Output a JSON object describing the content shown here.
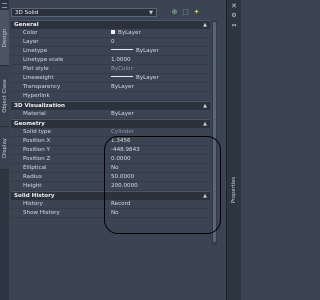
{
  "left_tabs": [
    "Design",
    "Object Class",
    "Display"
  ],
  "right_panel": {
    "label": "Properties"
  },
  "toolbar": {
    "selection": "3D Solid"
  },
  "categories": [
    {
      "title": "General",
      "rows": [
        {
          "name": "Color",
          "value": "ByLayer",
          "swatch": true
        },
        {
          "name": "Layer",
          "value": "0"
        },
        {
          "name": "Linetype",
          "value": "ByLayer",
          "line": true
        },
        {
          "name": "Linetype scale",
          "value": "1.0000"
        },
        {
          "name": "Plot style",
          "value": "ByColor",
          "style": "grey"
        },
        {
          "name": "Lineweight",
          "value": "ByLayer",
          "line": true
        },
        {
          "name": "Transparency",
          "value": "ByLayer"
        },
        {
          "name": "Hyperlink",
          "value": ""
        }
      ]
    },
    {
      "title": "3D Visualization",
      "rows": [
        {
          "name": "Material",
          "value": "ByLayer"
        }
      ]
    },
    {
      "title": "Geometry",
      "rows": [
        {
          "name": "Solid type",
          "value": "Cylinder",
          "style": "grey"
        },
        {
          "name": "Position X",
          "value": "1.3456"
        },
        {
          "name": "Position Y",
          "value": "-448.9843"
        },
        {
          "name": "Position Z",
          "value": "0.0000"
        },
        {
          "name": "Elliptical",
          "value": "No"
        },
        {
          "name": "Radius",
          "value": "50.0000"
        },
        {
          "name": "Height",
          "value": "200.0000"
        }
      ]
    },
    {
      "title": "Solid History",
      "rows": [
        {
          "name": "History",
          "value": "Record"
        },
        {
          "name": "Show History",
          "value": "No"
        }
      ]
    }
  ]
}
